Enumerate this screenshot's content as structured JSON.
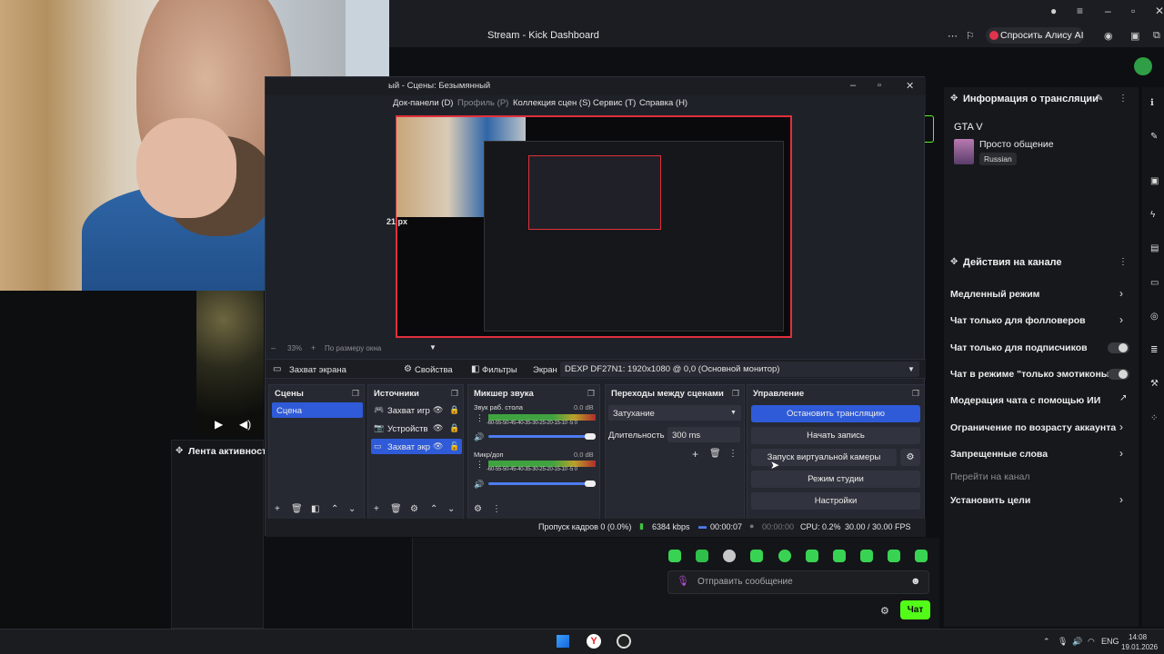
{
  "browser": {
    "page_title": "Stream - Kick Dashboard",
    "alice_button": "Спросить Алису AI",
    "colors": {
      "kick_green": "#53fc18",
      "alice_red": "#e0344c"
    }
  },
  "kick": {
    "stream_info": {
      "header": "Информация о трансляции",
      "game": "GTA V",
      "title": "Просто общение",
      "language_tag": "Russian"
    },
    "channel_actions": {
      "header": "Действия на канале",
      "items": [
        {
          "label": "Медленный режим",
          "control": "chevron"
        },
        {
          "label": "Чат только для фолловеров",
          "control": "chevron"
        },
        {
          "label": "Чат только для подписчиков",
          "control": "toggle"
        },
        {
          "label": "Чат в режиме \"только эмотиконы\"",
          "control": "toggle"
        },
        {
          "label": "Модерация чата с помощью ИИ",
          "control": "external"
        },
        {
          "label": "Ограничение по возрасту аккаунта",
          "control": "chevron"
        },
        {
          "label": "Запрещенные слова",
          "control": "chevron"
        },
        {
          "label": "Перейти на канал",
          "control": "none"
        },
        {
          "label": "Установить цели",
          "control": "chevron"
        }
      ]
    },
    "activity_feed_title": "Лента активности",
    "chat": {
      "placeholder": "Отправить сообщение",
      "send_label": "Чат"
    }
  },
  "obs": {
    "window_title": "ый - Сцены: Безымянный",
    "menu": [
      "Док-панели (D)",
      "Профиль (P)",
      "Коллекция сцен (S)",
      "Сервис (T)",
      "Справка (H)"
    ],
    "preview_px_label": "21 px",
    "zoom": "33%",
    "zoom_mode": "По размеру окна",
    "source_bar": {
      "source_name": "Захват экрана",
      "properties": "Свойства",
      "filters": "Фильтры",
      "screen_label": "Экран",
      "monitor": "DEXP DF27N1: 1920x1080 @ 0,0 (Основной монитор)"
    },
    "docks": {
      "scenes": {
        "title": "Сцены",
        "items": [
          "Сцена"
        ]
      },
      "sources": {
        "title": "Источники",
        "items": [
          "Захват игр",
          "Устройств",
          "Захват экр"
        ]
      },
      "mixer": {
        "title": "Микшер звука",
        "channels": [
          {
            "name": "Звук раб. стола",
            "db": "0.0 dB"
          },
          {
            "name": "Микр/доп",
            "db": "0.0 dB"
          }
        ],
        "scale": "-60-55-50-45-40-35-30-25-20-15-10 -5 0"
      },
      "transitions": {
        "title": "Переходы между сценами",
        "type": "Затухание",
        "duration_label": "Длительность",
        "duration": "300 ms"
      },
      "controls": {
        "title": "Управление",
        "buttons": [
          "Остановить трансляцию",
          "Начать запись",
          "Запуск виртуальной камеры",
          "Режим студии",
          "Настройки"
        ]
      }
    },
    "status": {
      "dropped": "Пропуск кадров 0 (0.0%)",
      "bitrate": "6384 kbps",
      "stream_time": "00:00:07",
      "rec_time": "00:00:00",
      "cpu": "CPU: 0.2%",
      "fps": "30.00 / 30.00 FPS"
    }
  },
  "taskbar": {
    "lang": "ENG",
    "time": "14:08",
    "date": "19.01.2026"
  }
}
